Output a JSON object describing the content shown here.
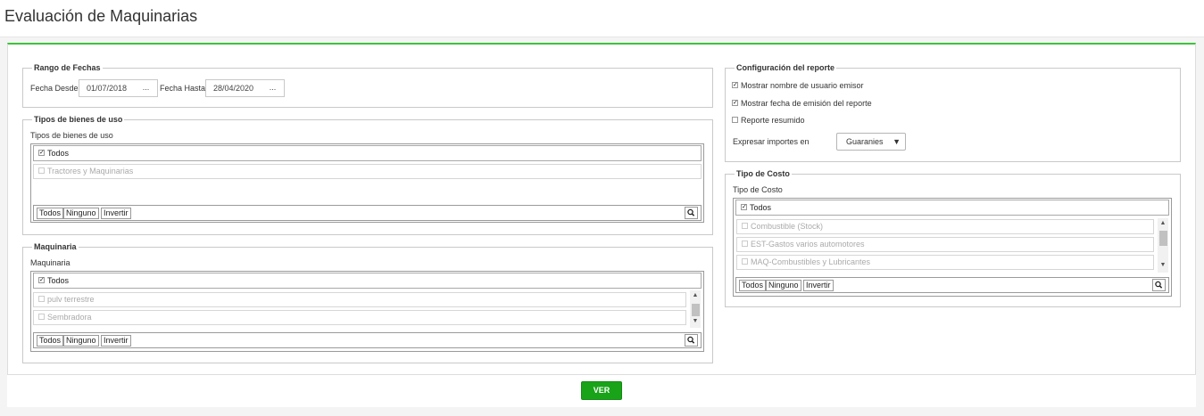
{
  "page": {
    "title": "Evaluación de Maquinarias"
  },
  "rango": {
    "legend": "Rango de Fechas",
    "desde_label": "Fecha Desde",
    "desde_value": "01/07/2018",
    "hasta_label": "Fecha Hasta",
    "hasta_value": "28/04/2020",
    "picker_label": "..."
  },
  "tipos_bienes": {
    "legend": "Tipos de bienes de uso",
    "label": "Tipos de bienes de uso",
    "todos": "Todos",
    "items": [
      "Tractores y Maquinarias"
    ]
  },
  "maquinaria": {
    "legend": "Maquinaria",
    "label": "Maquinaria",
    "todos": "Todos",
    "items": [
      "pulv terrestre",
      "Sembradora"
    ]
  },
  "config": {
    "legend": "Configuración del reporte",
    "opt_usuario": "Mostrar nombre de usuario emisor",
    "opt_usuario_checked": true,
    "opt_fecha": "Mostrar fecha de emisión del reporte",
    "opt_fecha_checked": true,
    "opt_resumido": "Reporte resumido",
    "opt_resumido_checked": false,
    "importes_label": "Expresar importes en",
    "importes_value": "Guaranies"
  },
  "tipo_costo": {
    "legend": "Tipo de Costo",
    "label": "Tipo de Costo",
    "todos": "Todos",
    "items": [
      "Combustible (Stock)",
      "EST-Gastos varios automotores",
      "MAQ-Combustibles y Lubricantes"
    ]
  },
  "list_buttons": {
    "todos": "Todos",
    "ninguno": "Ninguno",
    "invertir": "Invertir"
  },
  "footer": {
    "ver_label": "VER"
  },
  "colors": {
    "accent": "#3cc33c",
    "ver_button": "#19a319"
  }
}
